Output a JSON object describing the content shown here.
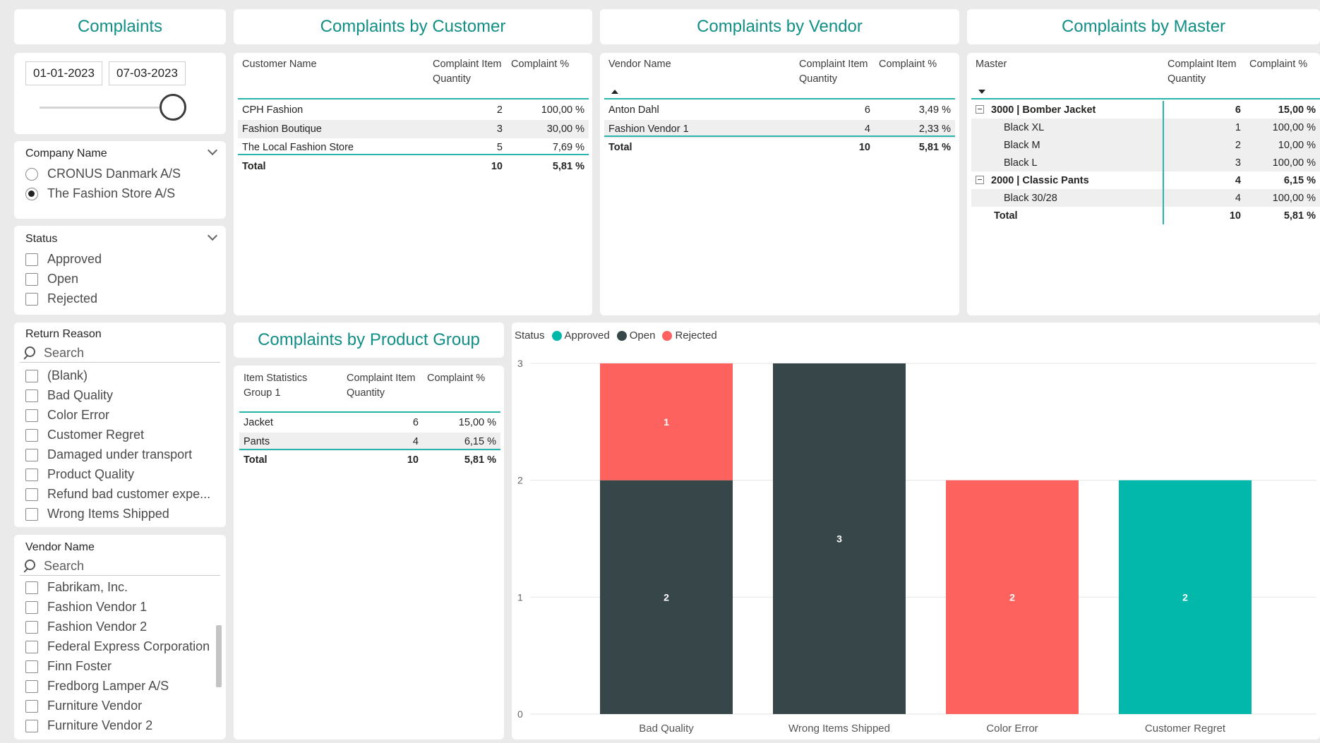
{
  "titles": {
    "complaints": "Complaints",
    "by_customer": "Complaints by Customer",
    "by_vendor": "Complaints by Vendor",
    "by_master": "Complaints by Master",
    "by_product_group": "Complaints by Product Group"
  },
  "date_slicer": {
    "start": "01-01-2023",
    "end": "07-03-2023"
  },
  "company_slicer": {
    "header": "Company Name",
    "options": [
      {
        "label": "CRONUS Danmark A/S",
        "selected": false
      },
      {
        "label": "The Fashion Store A/S",
        "selected": true
      }
    ]
  },
  "status_slicer": {
    "header": "Status",
    "options": [
      "Approved",
      "Open",
      "Rejected"
    ]
  },
  "return_reason_slicer": {
    "header": "Return Reason",
    "search_placeholder": "Search",
    "options": [
      "(Blank)",
      "Bad Quality",
      "Color Error",
      "Customer Regret",
      "Damaged under transport",
      "Product Quality",
      "Refund bad customer expe...",
      "Wrong Items Shipped"
    ]
  },
  "vendor_slicer": {
    "header": "Vendor Name",
    "search_placeholder": "Search",
    "options": [
      "Fabrikam, Inc.",
      "Fashion Vendor 1",
      "Fashion Vendor 2",
      "Federal Express Corporation",
      "Finn Foster",
      "Fredborg Lamper A/S",
      "Furniture Vendor",
      "Furniture Vendor 2"
    ]
  },
  "customer_table": {
    "columns": [
      "Customer Name",
      "Complaint Item Quantity",
      "Complaint %"
    ],
    "rows": [
      [
        "CPH Fashion",
        "2",
        "100,00 %"
      ],
      [
        "Fashion Boutique",
        "3",
        "30,00 %"
      ],
      [
        "The Local Fashion Store",
        "5",
        "7,69 %"
      ]
    ],
    "total": [
      "Total",
      "10",
      "5,81 %"
    ]
  },
  "vendor_table": {
    "columns": [
      "Vendor Name",
      "Complaint Item Quantity",
      "Complaint %"
    ],
    "rows": [
      [
        "Anton Dahl",
        "6",
        "3,49 %"
      ],
      [
        "Fashion Vendor 1",
        "4",
        "2,33 %"
      ]
    ],
    "total": [
      "Total",
      "10",
      "5,81 %"
    ]
  },
  "master_table": {
    "columns": [
      "Master",
      "Complaint Item Quantity",
      "Complaint %"
    ],
    "groups": [
      {
        "label": "3000 | Bomber Jacket",
        "qty": "6",
        "pct": "15,00 %",
        "children": [
          [
            "Black XL",
            "1",
            "100,00 %"
          ],
          [
            "Black M",
            "2",
            "10,00 %"
          ],
          [
            "Black L",
            "3",
            "100,00 %"
          ]
        ]
      },
      {
        "label": "2000 | Classic Pants",
        "qty": "4",
        "pct": "6,15 %",
        "children": [
          [
            "Black 30/28",
            "4",
            "100,00 %"
          ]
        ]
      }
    ],
    "total": [
      "Total",
      "10",
      "5,81 %"
    ]
  },
  "product_group_table": {
    "columns": [
      "Item Statistics Group 1",
      "Complaint Item Quantity",
      "Complaint %"
    ],
    "rows": [
      [
        "Jacket",
        "6",
        "15,00 %"
      ],
      [
        "Pants",
        "4",
        "6,15 %"
      ]
    ],
    "total": [
      "Total",
      "10",
      "5,81 %"
    ]
  },
  "chart_data": {
    "type": "bar",
    "stacked": true,
    "legend_title": "Status",
    "legend_position": "top-left",
    "categories": [
      "Bad Quality",
      "Wrong Items Shipped",
      "Color Error",
      "Customer Regret"
    ],
    "series": [
      {
        "name": "Approved",
        "color": "#01b8aa",
        "values": [
          0,
          0,
          0,
          2
        ]
      },
      {
        "name": "Open",
        "color": "#374649",
        "values": [
          2,
          3,
          0,
          0
        ]
      },
      {
        "name": "Rejected",
        "color": "#fd625e",
        "values": [
          1,
          0,
          2,
          0
        ]
      }
    ],
    "ylim": [
      0,
      3
    ],
    "yticks": [
      "0",
      "1",
      "2",
      "3"
    ],
    "grid": true
  }
}
